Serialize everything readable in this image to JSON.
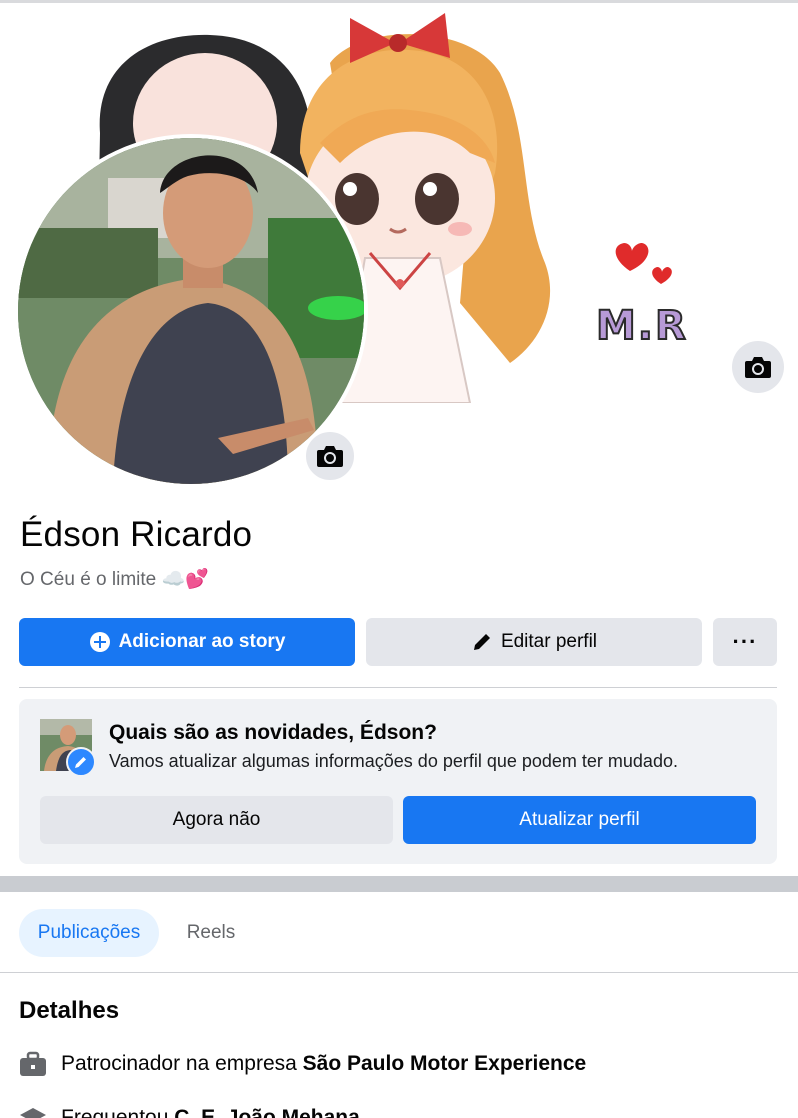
{
  "cover": {
    "monogram": "M.R"
  },
  "profile": {
    "name": "Édson Ricardo",
    "bio": "O Céu é o limite ☁️💕"
  },
  "actions": {
    "add_story_label": "Adicionar ao story",
    "edit_profile_label": "Editar perfil",
    "more_label": "···"
  },
  "update_card": {
    "title": "Quais são as novidades, Édson?",
    "subtitle": "Vamos atualizar algumas informações do perfil que podem ter mudado.",
    "later_label": "Agora não",
    "update_label": "Atualizar perfil"
  },
  "tabs": [
    {
      "label": "Publicações",
      "active": true
    },
    {
      "label": "Reels",
      "active": false
    }
  ],
  "details": {
    "title": "Detalhes",
    "items": [
      {
        "icon": "briefcase-icon",
        "prefix": "Patrocinador na empresa ",
        "value": "São Paulo Motor Experience"
      },
      {
        "icon": "graduation-cap-icon",
        "prefix": "Frequentou ",
        "value": "C. E. João Mehana"
      }
    ]
  },
  "colors": {
    "accent": "#1877f2",
    "button_gray": "#e4e6eb",
    "card_bg": "#f0f2f5",
    "secondary_text": "#65676b"
  }
}
